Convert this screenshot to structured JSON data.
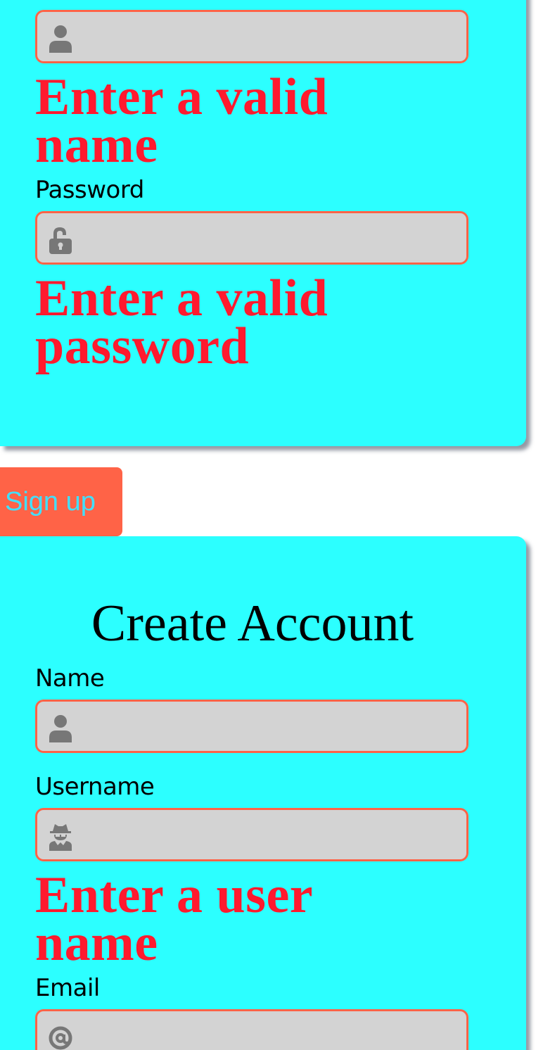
{
  "colors": {
    "card_bg": "#2cffff",
    "field_bg": "#d3d3d3",
    "field_border": "#ff6347",
    "error_text": "#ff1a2e",
    "button_bg": "#ff6347",
    "button_text": "#40e0ff",
    "icon_color": "#777777"
  },
  "login_form": {
    "name_field": {
      "icon": "user-icon",
      "value": "",
      "placeholder": ""
    },
    "name_error": "Enter a valid name",
    "password_label": "Password",
    "password_field": {
      "icon": "unlock-icon",
      "value": "",
      "placeholder": ""
    },
    "password_error": "Enter a valid password"
  },
  "signup_button": {
    "label": "Sign up"
  },
  "signup_form": {
    "title": "Create Account",
    "name_label": "Name",
    "name_field": {
      "icon": "user-icon",
      "value": "",
      "placeholder": ""
    },
    "username_label": "Username",
    "username_field": {
      "icon": "user-secret-icon",
      "value": "",
      "placeholder": ""
    },
    "username_error": "Enter a user name",
    "email_label": "Email",
    "email_field": {
      "icon": "at-icon",
      "value": "",
      "placeholder": ""
    }
  }
}
